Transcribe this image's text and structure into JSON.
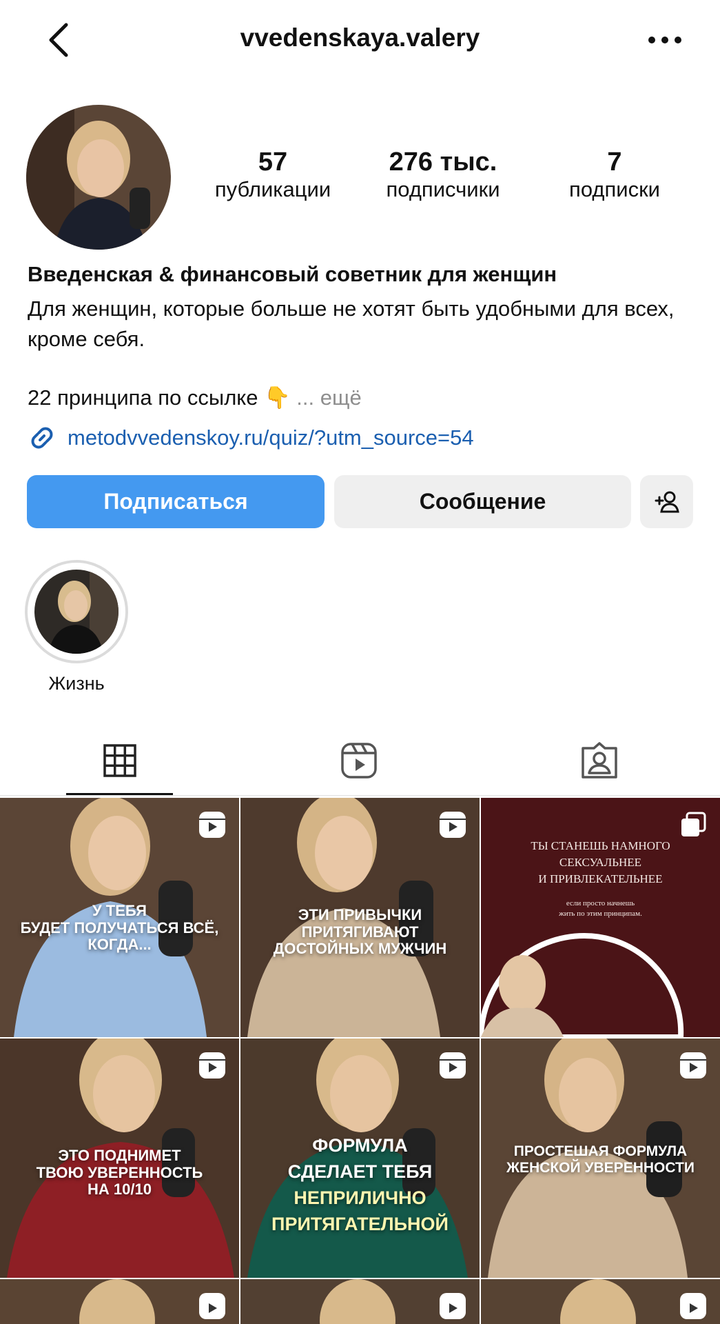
{
  "header": {
    "back_icon": "chevron-left-icon",
    "username": "vvedenskaya.valery",
    "more_icon": "more-horizontal-icon"
  },
  "profile": {
    "stats": [
      {
        "value": "57",
        "label": "публикации"
      },
      {
        "value": "276 тыс.",
        "label": "подписчики"
      },
      {
        "value": "7",
        "label": "подписки"
      }
    ],
    "name": "Введенская & финансовый советник для женщин",
    "bio": "Для женщин, которые больше не хотят быть удобными для всех, кроме себя.",
    "bio_line3": "22 принципа по ссылке 👇",
    "bio_more": "... ещё",
    "link": "metodvvedenskoy.ru/quiz/?utm_source=54"
  },
  "buttons": {
    "follow": "Подписаться",
    "message": "Сообщение",
    "add_user_icon": "add-person-icon"
  },
  "highlights": [
    {
      "label": "Жизнь"
    }
  ],
  "tabs": [
    {
      "icon": "grid-icon",
      "active": true
    },
    {
      "icon": "reels-icon",
      "active": false
    },
    {
      "icon": "tagged-icon",
      "active": false
    }
  ],
  "grid": [
    {
      "caption": [
        "У ТЕБЯ",
        "БУДЕТ ПОЛУЧАТЬСЯ ВСЁ,",
        "КОГДА..."
      ],
      "type": "reel"
    },
    {
      "caption": [
        "ЭТИ ПРИВЫЧКИ",
        "ПРИТЯГИВАЮТ",
        "ДОСТОЙНЫХ МУЖЧИН"
      ],
      "type": "reel"
    },
    {
      "title": [
        "ТЫ СТАНЕШЬ НАМНОГО",
        "СЕКСУАЛЬНЕЕ",
        "И ПРИВЛЕКАТЕЛЬНЕЕ"
      ],
      "subtitle": [
        "если просто начнешь",
        "жить по этим принципам."
      ],
      "type": "carousel"
    },
    {
      "caption": [
        "ЭТО ПОДНИМЕТ",
        "ТВОЮ УВЕРЕННОСТЬ",
        "НА 10/10"
      ],
      "type": "reel"
    },
    {
      "caption": [
        "ФОРМУЛА",
        "СДЕЛАЕТ ТЕБЯ"
      ],
      "caption_yellow": [
        "НЕПРИЛИЧНО",
        "ПРИТЯГАТЕЛЬНОЙ"
      ],
      "type": "reel"
    },
    {
      "caption": [
        "ПРОСТЕШАЯ ФОРМУЛА",
        "ЖЕНСКОЙ УВЕРЕННОСТИ"
      ],
      "type": "reel"
    }
  ]
}
